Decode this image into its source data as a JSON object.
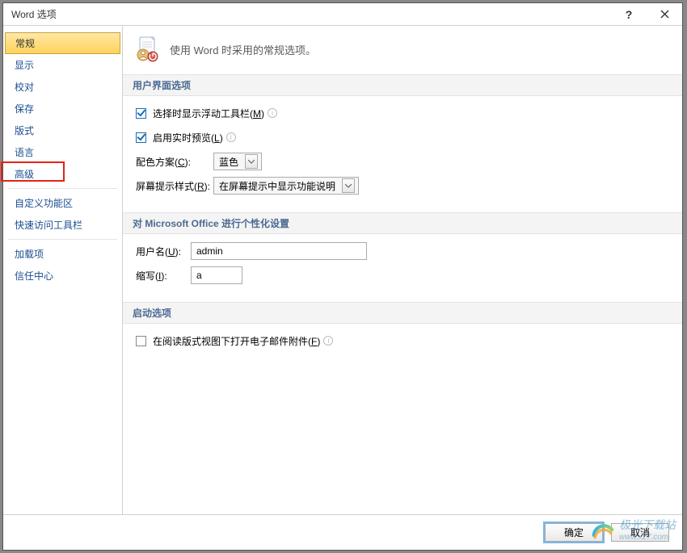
{
  "window": {
    "title": "Word 选项"
  },
  "sidebar": {
    "items": [
      {
        "label": "常规",
        "selected": true
      },
      {
        "label": "显示"
      },
      {
        "label": "校对"
      },
      {
        "label": "保存"
      },
      {
        "label": "版式"
      },
      {
        "label": "语言"
      },
      {
        "label": "高级",
        "highlighted": true
      },
      {
        "divider": true
      },
      {
        "label": "自定义功能区"
      },
      {
        "label": "快速访问工具栏"
      },
      {
        "divider": true
      },
      {
        "label": "加载项"
      },
      {
        "label": "信任中心"
      }
    ]
  },
  "header": {
    "text": "使用 Word 时采用的常规选项。"
  },
  "sections": {
    "ui": {
      "title": "用户界面选项",
      "show_mini_toolbar": {
        "label_a": "选择时显示浮动工具栏(",
        "key": "M",
        "label_b": ")",
        "checked": true
      },
      "live_preview": {
        "label_a": "启用实时预览(",
        "key": "L",
        "label_b": ")",
        "checked": true
      },
      "color_scheme": {
        "label_a": "配色方案(",
        "key": "C",
        "label_b": "):",
        "value": "蓝色"
      },
      "screentip": {
        "label_a": "屏幕提示样式(",
        "key": "R",
        "label_b": "):",
        "value": "在屏幕提示中显示功能说明"
      }
    },
    "personalize": {
      "title": "对 Microsoft Office 进行个性化设置",
      "username": {
        "label_a": "用户名(",
        "key": "U",
        "label_b": "):",
        "value": "admin"
      },
      "initials": {
        "label_a": "缩写(",
        "key": "I",
        "label_b": "):",
        "value": "a"
      }
    },
    "startup": {
      "title": "启动选项",
      "open_attachments": {
        "label_a": "在阅读版式视图下打开电子邮件附件(",
        "key": "F",
        "label_b": ")",
        "checked": false
      }
    }
  },
  "footer": {
    "ok": "确定",
    "cancel": "取消"
  },
  "watermark": {
    "text1": "极光下载站",
    "text2": "www.xz7.com"
  }
}
